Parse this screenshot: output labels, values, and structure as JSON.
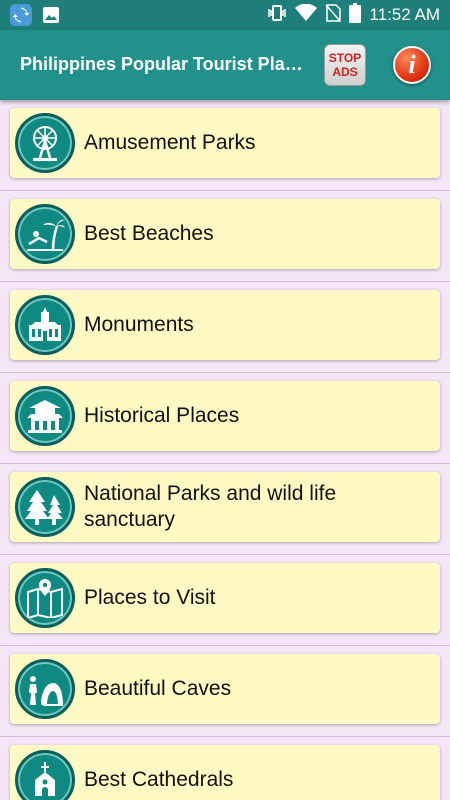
{
  "status_bar": {
    "time": "11:52 AM",
    "icons": [
      "sync-app-icon",
      "image-icon",
      "vibrate-icon",
      "wifi-icon",
      "no-sim-icon",
      "battery-icon"
    ]
  },
  "app_bar": {
    "title": "Philippines Popular Tourist Places",
    "stop_ads_line1": "STOP",
    "stop_ads_line2": "ADS",
    "info_label": "i"
  },
  "colors": {
    "status_bar": "#1f7f7a",
    "app_bar": "#23918b",
    "card": "#fff9c4",
    "background": "#f5e6f7",
    "icon_circle": "#0f8a82"
  },
  "categories": [
    {
      "label": "Amusement Parks",
      "icon": "ferris-wheel-icon"
    },
    {
      "label": "Best Beaches",
      "icon": "beach-icon"
    },
    {
      "label": "Monuments",
      "icon": "monument-icon"
    },
    {
      "label": "Historical Places",
      "icon": "pagoda-icon"
    },
    {
      "label": "National Parks and wild life sanctuary",
      "icon": "trees-icon"
    },
    {
      "label": "Places to Visit",
      "icon": "map-pin-icon"
    },
    {
      "label": "Beautiful Caves",
      "icon": "cave-icon"
    },
    {
      "label": "Best Cathedrals",
      "icon": "cathedral-icon"
    }
  ]
}
